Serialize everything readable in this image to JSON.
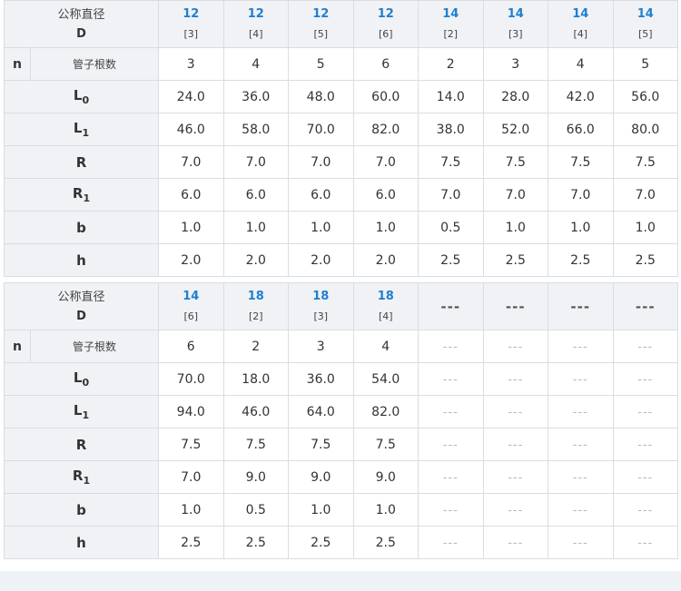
{
  "header_title": "公称直径",
  "header_symbol": "D",
  "n_label": "n",
  "n_sub": "管子根数",
  "row_labels": [
    {
      "main": "L",
      "sub": "0"
    },
    {
      "main": "L",
      "sub": "1"
    },
    {
      "main": "R",
      "sub": ""
    },
    {
      "main": "R",
      "sub": "1"
    },
    {
      "main": "b",
      "sub": ""
    },
    {
      "main": "h",
      "sub": ""
    }
  ],
  "dash_text": "---",
  "tables": [
    {
      "columns": [
        {
          "d": "12",
          "pipes": "[3]",
          "n": "3",
          "values": [
            "24.0",
            "46.0",
            "7.0",
            "6.0",
            "1.0",
            "2.0"
          ]
        },
        {
          "d": "12",
          "pipes": "[4]",
          "n": "4",
          "values": [
            "36.0",
            "58.0",
            "7.0",
            "6.0",
            "1.0",
            "2.0"
          ]
        },
        {
          "d": "12",
          "pipes": "[5]",
          "n": "5",
          "values": [
            "48.0",
            "70.0",
            "7.0",
            "6.0",
            "1.0",
            "2.0"
          ]
        },
        {
          "d": "12",
          "pipes": "[6]",
          "n": "6",
          "values": [
            "60.0",
            "82.0",
            "7.0",
            "6.0",
            "1.0",
            "2.0"
          ]
        },
        {
          "d": "14",
          "pipes": "[2]",
          "n": "2",
          "values": [
            "14.0",
            "38.0",
            "7.5",
            "7.0",
            "0.5",
            "2.5"
          ]
        },
        {
          "d": "14",
          "pipes": "[3]",
          "n": "3",
          "values": [
            "28.0",
            "52.0",
            "7.5",
            "7.0",
            "1.0",
            "2.5"
          ]
        },
        {
          "d": "14",
          "pipes": "[4]",
          "n": "4",
          "values": [
            "42.0",
            "66.0",
            "7.5",
            "7.0",
            "1.0",
            "2.5"
          ]
        },
        {
          "d": "14",
          "pipes": "[5]",
          "n": "5",
          "values": [
            "56.0",
            "80.0",
            "7.5",
            "7.0",
            "1.0",
            "2.5"
          ]
        }
      ]
    },
    {
      "columns": [
        {
          "d": "14",
          "pipes": "[6]",
          "n": "6",
          "values": [
            "70.0",
            "94.0",
            "7.5",
            "7.0",
            "1.0",
            "2.5"
          ]
        },
        {
          "d": "18",
          "pipes": "[2]",
          "n": "2",
          "values": [
            "18.0",
            "46.0",
            "7.5",
            "9.0",
            "0.5",
            "2.5"
          ]
        },
        {
          "d": "18",
          "pipes": "[3]",
          "n": "3",
          "values": [
            "36.0",
            "64.0",
            "7.5",
            "9.0",
            "1.0",
            "2.5"
          ]
        },
        {
          "d": "18",
          "pipes": "[4]",
          "n": "4",
          "values": [
            "54.0",
            "82.0",
            "7.5",
            "9.0",
            "1.0",
            "2.5"
          ]
        },
        {
          "empty": true
        },
        {
          "empty": true
        },
        {
          "empty": true
        },
        {
          "empty": true
        }
      ]
    }
  ]
}
